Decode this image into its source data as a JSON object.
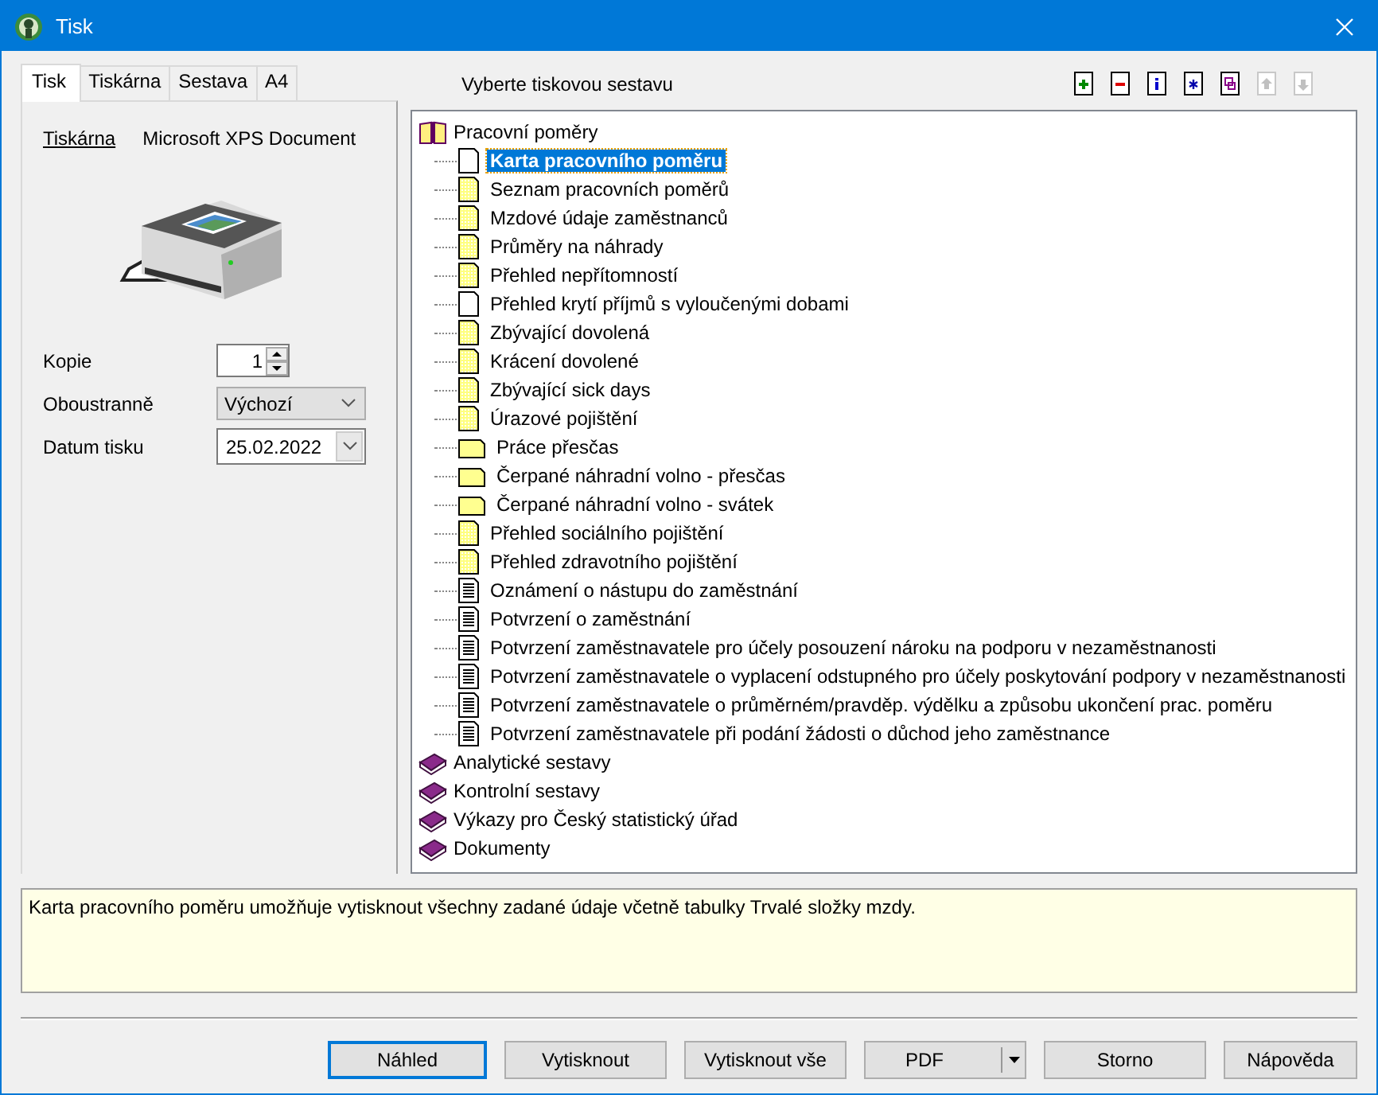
{
  "window": {
    "title": "Tisk"
  },
  "tabs": [
    {
      "label": "Tisk",
      "selected": true
    },
    {
      "label": "Tiskárna",
      "selected": false
    },
    {
      "label": "Sestava",
      "selected": false
    },
    {
      "label": "A4",
      "selected": false
    }
  ],
  "printer": {
    "link": "Tiskárna",
    "name": "Microsoft XPS Document"
  },
  "form": [
    {
      "kind": "spinner",
      "label": "Kopie",
      "value": "1"
    },
    {
      "kind": "select",
      "label": "Oboustranně",
      "value": "Výchozí"
    },
    {
      "kind": "date",
      "label": "Datum tisku",
      "value": "25.02.2022"
    }
  ],
  "report_title": "Vyberte tiskovou sestavu",
  "toolbar": [
    {
      "kind": "add",
      "disabled": false
    },
    {
      "kind": "remove",
      "disabled": false
    },
    {
      "kind": "info",
      "disabled": false
    },
    {
      "kind": "star",
      "disabled": false
    },
    {
      "kind": "copy",
      "disabled": false
    },
    {
      "kind": "up",
      "disabled": true
    },
    {
      "kind": "down",
      "disabled": true
    }
  ],
  "tree": [
    {
      "label": "Pracovní poměry",
      "expanded": true,
      "children": [
        {
          "label": "Karta pracovního poměru",
          "kind": "blank",
          "selected": true
        },
        {
          "label": "Seznam pracovních poměrů",
          "kind": "yellow",
          "selected": false
        },
        {
          "label": "Mzdové údaje zaměstnanců",
          "kind": "yellow",
          "selected": false
        },
        {
          "label": "Průměry na náhrady",
          "kind": "yellow",
          "selected": false
        },
        {
          "label": "Přehled nepřítomností",
          "kind": "yellow",
          "selected": false
        },
        {
          "label": "Přehled krytí příjmů s vyloučenými dobami",
          "kind": "blank",
          "selected": false
        },
        {
          "label": "Zbývající dovolená",
          "kind": "yellow",
          "selected": false
        },
        {
          "label": "Krácení dovolené",
          "kind": "yellow",
          "selected": false
        },
        {
          "label": "Zbývající sick days",
          "kind": "yellow",
          "selected": false
        },
        {
          "label": "Úrazové pojištění",
          "kind": "yellow",
          "selected": false
        },
        {
          "label": "Práce přesčas",
          "kind": "landscape",
          "selected": false
        },
        {
          "label": "Čerpané náhradní volno - přesčas",
          "kind": "landscape",
          "selected": false
        },
        {
          "label": "Čerpané náhradní volno - svátek",
          "kind": "landscape",
          "selected": false
        },
        {
          "label": "Přehled sociálního pojištění",
          "kind": "yellow",
          "selected": false
        },
        {
          "label": "Přehled zdravotního pojištění",
          "kind": "yellow",
          "selected": false
        },
        {
          "label": "Oznámení o nástupu do zaměstnání",
          "kind": "text",
          "selected": false
        },
        {
          "label": "Potvrzení o zaměstnání",
          "kind": "text",
          "selected": false
        },
        {
          "label": "Potvrzení zaměstnavatele pro účely posouzení nároku na podporu v nezaměstnanosti",
          "kind": "text",
          "selected": false
        },
        {
          "label": "Potvrzení zaměstnavatele o vyplacení odstupného pro účely poskytování podpory v nezaměstnanosti",
          "kind": "text",
          "selected": false
        },
        {
          "label": "Potvrzení zaměstnavatele o průměrném/pravděp. výdělku a způsobu ukončení prac. poměru",
          "kind": "text",
          "selected": false
        },
        {
          "label": "Potvrzení zaměstnavatele při podání žádosti o důchod jeho zaměstnance",
          "kind": "text",
          "selected": false
        }
      ]
    },
    {
      "label": "Analytické sestavy",
      "expanded": false
    },
    {
      "label": "Kontrolní sestavy",
      "expanded": false
    },
    {
      "label": "Výkazy pro Český statistický úřad",
      "expanded": false
    },
    {
      "label": "Dokumenty",
      "expanded": false
    }
  ],
  "description": "Karta pracovního poměru umožňuje vytisknout všechny zadané údaje včetně tabulky Trvalé složky mzdy.",
  "buttons": [
    {
      "label": "Náhled",
      "kind": "default"
    },
    {
      "label": "Vytisknout",
      "kind": "plain"
    },
    {
      "label": "Vytisknout vše",
      "kind": "plain"
    },
    {
      "label": "PDF",
      "kind": "split"
    },
    {
      "label": "Storno",
      "kind": "plain"
    },
    {
      "label": "Nápověda",
      "kind": "plain"
    }
  ]
}
